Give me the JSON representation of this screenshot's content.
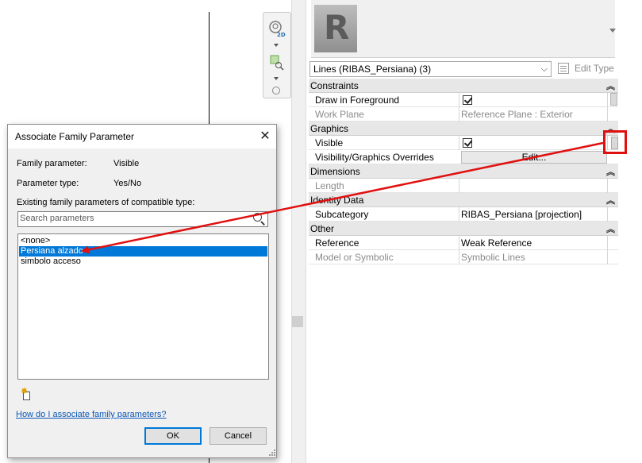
{
  "navbar": {
    "steering_icon": "steering-wheel-2d-icon",
    "zoom_icon": "zoom-region-icon",
    "steering_badge": "2D"
  },
  "properties": {
    "logo_letter": "R",
    "type_selector": "Lines (RIBAS_Persiana) (3)",
    "edit_type": "Edit Type",
    "sections": {
      "constraints": "Constraints",
      "graphics": "Graphics",
      "dimensions": "Dimensions",
      "identity": "Identity Data",
      "other": "Other"
    },
    "rows": {
      "draw_fg": {
        "key": "Draw in Foreground",
        "checked": true
      },
      "work_plane": {
        "key": "Work Plane",
        "value": "Reference Plane : Exterior"
      },
      "visible": {
        "key": "Visible",
        "checked": true
      },
      "vg_overrides": {
        "key": "Visibility/Graphics Overrides",
        "value": "Edit..."
      },
      "length": {
        "key": "Length",
        "value": ""
      },
      "subcategory": {
        "key": "Subcategory",
        "value": "RIBAS_Persiana [projection]"
      },
      "reference": {
        "key": "Reference",
        "value": "Weak Reference"
      },
      "model_symbolic": {
        "key": "Model or Symbolic",
        "value": "Symbolic Lines"
      }
    },
    "collapse_glyph": "⌃"
  },
  "dialog": {
    "title": "Associate Family Parameter",
    "family_param_label": "Family parameter:",
    "family_param_value": "Visible",
    "param_type_label": "Parameter type:",
    "param_type_value": "Yes/No",
    "existing_label": "Existing family parameters of compatible type:",
    "search_placeholder": "Search parameters",
    "list": [
      "<none>",
      "Persiana alzado",
      "simbolo acceso"
    ],
    "selected_index": 1,
    "help_link": "How do I associate family parameters?",
    "ok": "OK",
    "cancel": "Cancel"
  },
  "annotation": {
    "color": "#e01010"
  }
}
